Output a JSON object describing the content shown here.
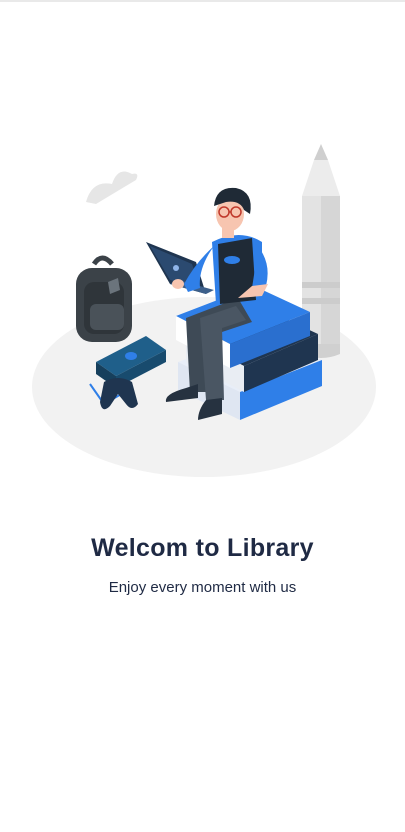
{
  "welcome": {
    "title": "Welcom to Library",
    "subtitle": "Enjoy every moment with us"
  },
  "illustration": {
    "name": "student-reading-illustration",
    "colors": {
      "accent_blue": "#2f7fe8",
      "dark_navy": "#1f3550",
      "ground_gray": "#f2f2f2",
      "pencil_gray": "#e3e3e3",
      "bag_gray": "#3b4248"
    }
  }
}
